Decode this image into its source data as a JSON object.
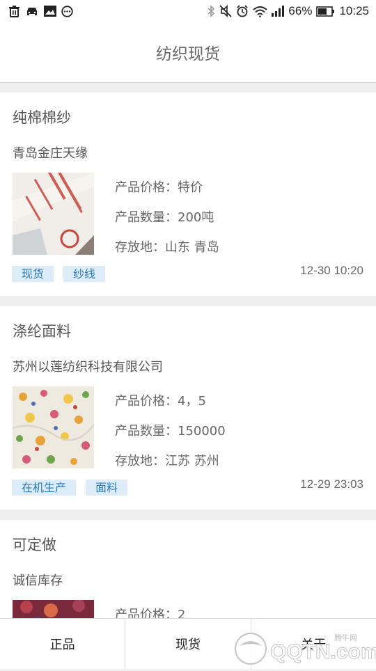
{
  "status_bar": {
    "battery_percent": "66%",
    "time": "10:25",
    "left_icons": [
      "trash-icon",
      "car-icon",
      "image-icon",
      "more-circle-icon"
    ],
    "right_icons": [
      "bluetooth-icon",
      "mute-icon",
      "alarm-icon",
      "wifi-icon",
      "signal-icon",
      "battery-icon"
    ]
  },
  "header": {
    "title": "纺织现货"
  },
  "cards": [
    {
      "title": "纯棉棉纱",
      "company": "青岛金庄天缘",
      "price": "产品价格：特价",
      "quantity": "产品数量：200吨",
      "location": "存放地：山东 青岛",
      "tags": [
        "现货",
        "纱线"
      ],
      "time": "12-30 10:20"
    },
    {
      "title": "涤纶面料",
      "company": "苏州以莲纺织科技有限公司",
      "price": "产品价格：4，5",
      "quantity": "产品数量：150000",
      "location": "存放地：江苏 苏州",
      "tags": [
        "在机生产",
        "面料"
      ],
      "time": "12-29 23:03"
    },
    {
      "title": "可定做",
      "company": "诚信库存",
      "price": "产品价格：2"
    }
  ],
  "tabbar": {
    "tabs": [
      "正品",
      "现货",
      "关于"
    ]
  },
  "watermark": {
    "text": "QQTN.com",
    "small": "腾牛网"
  },
  "colors": {
    "tag_bg": "#dcedf9",
    "tag_text": "#2b78ba",
    "page_bg": "#efefef"
  }
}
